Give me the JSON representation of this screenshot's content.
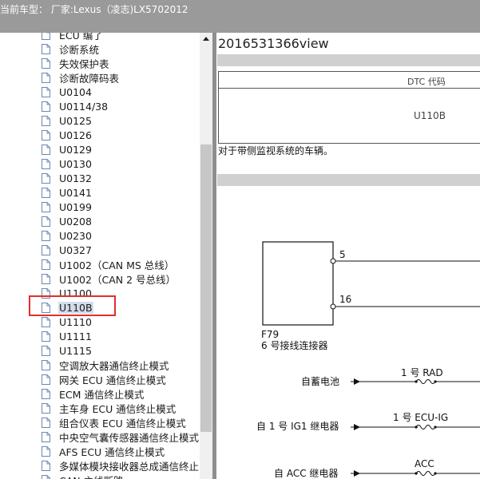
{
  "header": {
    "title": "当前车型：  厂家:Lexus（凌志)LX5702012"
  },
  "tree": {
    "items": [
      {
        "label": "ECU 编了"
      },
      {
        "label": "诊断系统"
      },
      {
        "label": "失效保护表"
      },
      {
        "label": "诊断故障码表"
      },
      {
        "label": "U0104"
      },
      {
        "label": "U0114/38"
      },
      {
        "label": "U0125"
      },
      {
        "label": "U0126"
      },
      {
        "label": "U0129"
      },
      {
        "label": "U0130"
      },
      {
        "label": "U0132"
      },
      {
        "label": "U0141"
      },
      {
        "label": "U0199"
      },
      {
        "label": "U0208"
      },
      {
        "label": "U0230"
      },
      {
        "label": "U0327"
      },
      {
        "label": "U1002（CAN MS 总线）"
      },
      {
        "label": "U1002（CAN 2 号总线）"
      },
      {
        "label": "U1100"
      },
      {
        "label": "U110B",
        "selected": true
      },
      {
        "label": "U1110"
      },
      {
        "label": "U1111"
      },
      {
        "label": "U1115"
      },
      {
        "label": "空调放大器通信终止模式"
      },
      {
        "label": "网关 ECU 通信终止模式"
      },
      {
        "label": "ECM 通信终止模式"
      },
      {
        "label": "主车身 ECU 通信终止模式"
      },
      {
        "label": "组合仪表 ECU 通信终止模式"
      },
      {
        "label": "中央空气囊传感器通信终止模式"
      },
      {
        "label": "AFS ECU 通信终止模式"
      },
      {
        "label": "多媒体模块接收器总成通信终止"
      },
      {
        "label": "CAN 主线断路"
      }
    ]
  },
  "document": {
    "title": "2016531366view",
    "dtc_header": "DTC 代码",
    "dtc_code": "U110B",
    "description": "对于带侧监视系统的车辆。",
    "diagram": {
      "connector_id": "F79",
      "connector_name": "6 号接线连接器",
      "pin_a": "5",
      "pin_b": "16",
      "source_1": "自蓄电池",
      "fuse_1": "1 号 RAD",
      "source_2": "自 1 号 IG1 继电器",
      "fuse_2": "1 号 ECU-IG",
      "source_3": "自 ACC 继电器",
      "fuse_3": "ACC"
    }
  },
  "colors": {
    "header_bg": "#9a9a9a",
    "selection_bg": "#d3dcea",
    "highlight_border": "#e0302a"
  }
}
